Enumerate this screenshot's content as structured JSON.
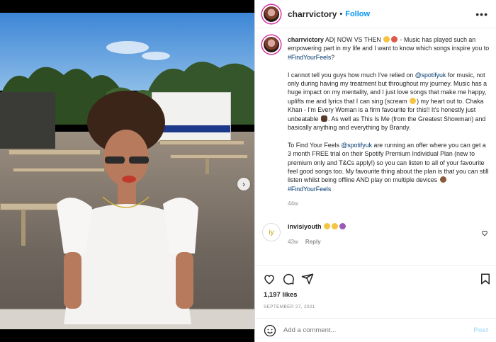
{
  "post": {
    "username": "charrvictory",
    "follow_sep": "•",
    "follow_label": "Follow",
    "more_label": "•••"
  },
  "caption": {
    "username": "charrvictory",
    "line1": "AD| NOW VS THEN",
    "line1b": "- Music has played such an empowering part in my life and I want to know which songs inspire you to",
    "tag1": "#FindYourFeels",
    "p2a": "I cannot tell you guys how much I've relied on",
    "mention1": "@spotifyuk",
    "p2b": "for music, not only during having my treatment but throughout my journey. Music has a huge impact on my mentality, and I just love songs that make me happy, uplifts me and lyrics that I can sing (scream",
    "p2c": ") my heart out to. Chaka Khan - I'm Every Woman is a firm favourite for this!! It's honestly just unbeatable",
    "p2d": ". As well as This Is Me (from the Greatest Showman) and basically anything and everything by Brandy.",
    "p3a": "To Find Your Feels",
    "mention2": "@spotifyuk",
    "p3b": "are running an offer where you can get a 3 month FREE trial on their Spotify Premium Individual Plan (new to premium only and T&Cs apply!) so you can listen to all of your favourite feel good songs too. My favourite thing about the plan is that you can still listen whilst being offline AND play on multiple devices",
    "tag2": "#FindYourFeels",
    "time": "44w"
  },
  "comment": {
    "username": "invisiyouth",
    "time": "43w",
    "reply_label": "Reply",
    "avatar_text": "iy"
  },
  "likes": "1,197 likes",
  "date": "SEPTEMBER 27, 2021",
  "add_comment": {
    "placeholder": "Add a comment...",
    "post_label": "Post"
  },
  "icons": {
    "heart": "heart-icon",
    "comment": "comment-icon",
    "share": "share-icon",
    "save": "bookmark-icon",
    "emoji": "emoji-icon",
    "next": "chevron-right-icon"
  },
  "colors": {
    "link": "#00376b",
    "follow": "#0095f6",
    "muted": "#8e8e8e",
    "post_disabled": "#b2dffc"
  }
}
